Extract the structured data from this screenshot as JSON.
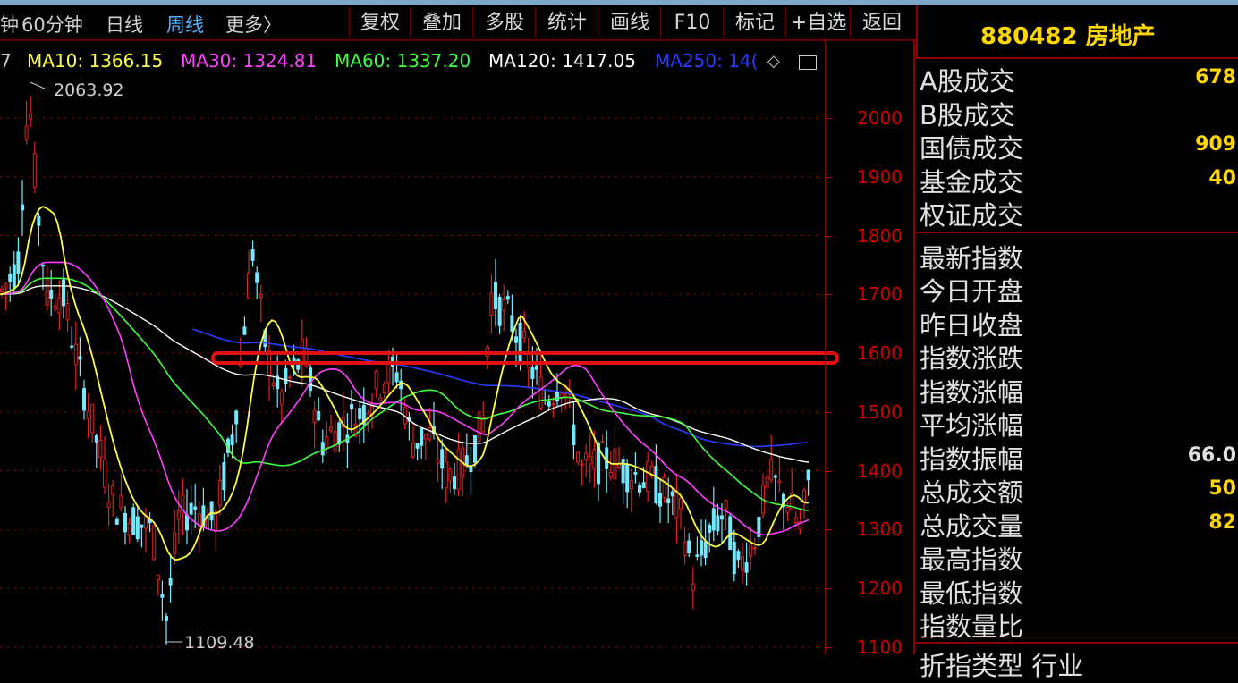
{
  "toolbar": {
    "periods": [
      "钟",
      "60分钟",
      "日线",
      "周线",
      "更多〉"
    ],
    "buttons": [
      "复权",
      "叠加",
      "多股",
      "统计",
      "画线",
      "F10",
      "标记",
      "+自选",
      "返回"
    ]
  },
  "title": {
    "code": "880482 房地产"
  },
  "ma_legend": {
    "prefix": "7",
    "ma10": "MA10: 1366.15",
    "ma30": "MA30: 1324.81",
    "ma60": "MA60: 1337.20",
    "ma120": "MA120: 1417.05",
    "ma250": "MA250: 14("
  },
  "annotations": {
    "high": "2063.92",
    "low": "1109.48"
  },
  "y_axis": [
    "2000",
    "1900",
    "1800",
    "1700",
    "1600",
    "1500",
    "1400",
    "1300",
    "1200",
    "1100"
  ],
  "panel": {
    "group1": [
      {
        "label": "A股成交",
        "value": "678"
      },
      {
        "label": "B股成交",
        "value": ""
      },
      {
        "label": "国债成交",
        "value": "909"
      },
      {
        "label": "基金成交",
        "value": "40"
      },
      {
        "label": "权证成交",
        "value": ""
      }
    ],
    "group2": [
      {
        "label": "最新指数",
        "value": ""
      },
      {
        "label": "今日开盘",
        "value": ""
      },
      {
        "label": "昨日收盘",
        "value": ""
      },
      {
        "label": "指数涨跌",
        "value": ""
      },
      {
        "label": "指数涨幅",
        "value": ""
      },
      {
        "label": "平均涨幅",
        "value": ""
      },
      {
        "label": "指数振幅",
        "value": "66.0"
      },
      {
        "label": "总成交额",
        "value": "50"
      },
      {
        "label": "总成交量",
        "value": "82"
      },
      {
        "label": "最高指数",
        "value": ""
      },
      {
        "label": "最低指数",
        "value": ""
      },
      {
        "label": "指数量比",
        "value": ""
      }
    ],
    "cut_row": "折指类型    行业"
  },
  "colors": {
    "ma10": "#ffff40",
    "ma30": "#ff40ff",
    "ma60": "#40ff40",
    "ma120": "#ffffff",
    "ma250": "#2a3dff",
    "axis": "#c00000",
    "resistance": "#e01010",
    "candle": "#74e8ff",
    "candle_down": "#e02020"
  }
}
